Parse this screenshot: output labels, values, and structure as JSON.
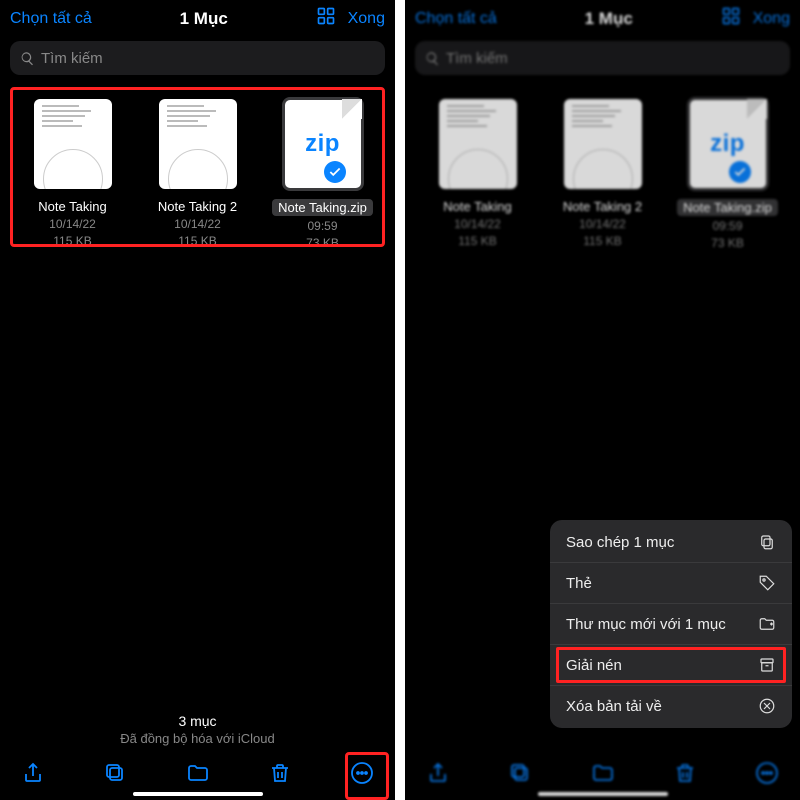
{
  "left": {
    "topbar": {
      "select_all": "Chọn tất cả",
      "title": "1 Mục",
      "done": "Xong"
    },
    "search_placeholder": "Tìm kiếm",
    "files": [
      {
        "name": "Note Taking",
        "date": "10/14/22",
        "size": "115 KB",
        "type": "doc",
        "selected": false
      },
      {
        "name": "Note Taking 2",
        "date": "10/14/22",
        "size": "115 KB",
        "type": "doc",
        "selected": false
      },
      {
        "name": "Note Taking.zip",
        "date": "09:59",
        "size": "73 KB",
        "type": "zip",
        "selected": true
      }
    ],
    "footer": {
      "count": "3 mục",
      "sync": "Đã đồng bộ hóa với iCloud"
    }
  },
  "right": {
    "topbar": {
      "select_all": "Chọn tất cả",
      "title": "1 Mục",
      "done": "Xong"
    },
    "search_placeholder": "Tìm kiếm",
    "files": [
      {
        "name": "Note Taking",
        "date": "10/14/22",
        "size": "115 KB",
        "type": "doc",
        "selected": false
      },
      {
        "name": "Note Taking 2",
        "date": "10/14/22",
        "size": "115 KB",
        "type": "doc",
        "selected": false
      },
      {
        "name": "Note Taking.zip",
        "date": "09:59",
        "size": "73 KB",
        "type": "zip",
        "selected": true
      }
    ],
    "menu": [
      {
        "label": "Sao chép 1 mục",
        "icon": "copy",
        "highlight": false
      },
      {
        "label": "Thẻ",
        "icon": "tag",
        "highlight": false
      },
      {
        "label": "Thư mục mới với 1 mục",
        "icon": "new-folder",
        "highlight": false
      },
      {
        "label": "Giải nén",
        "icon": "archive",
        "highlight": true
      },
      {
        "label": "Xóa bản tải về",
        "icon": "remove-download",
        "highlight": false
      }
    ]
  },
  "colors": {
    "accent": "#0a84ff",
    "highlight": "#ff2222"
  },
  "zip_label": "zip"
}
